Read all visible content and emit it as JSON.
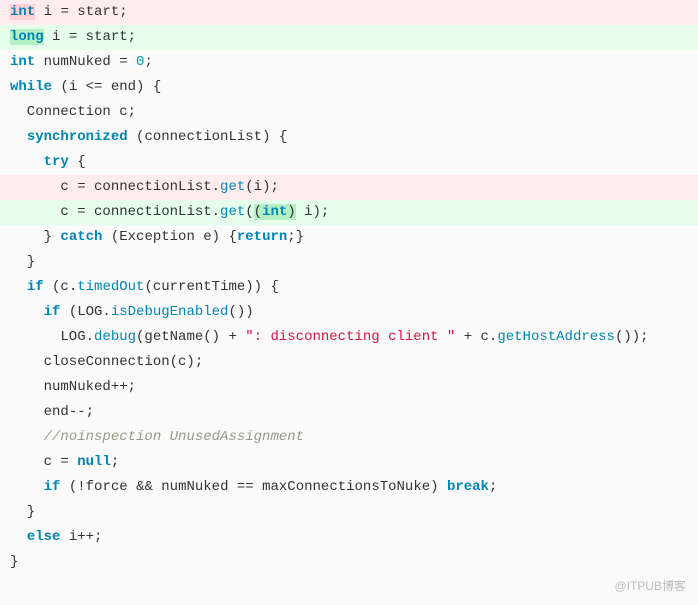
{
  "lines": [
    {
      "cls": "line line-removed",
      "parts": [
        {
          "t": "int",
          "c": "kw hl-removed"
        },
        {
          "t": " i "
        },
        {
          "t": "=",
          "c": "op"
        },
        {
          "t": " start;"
        }
      ]
    },
    {
      "cls": "line line-added",
      "parts": [
        {
          "t": "long",
          "c": "kw hl-added"
        },
        {
          "t": " i "
        },
        {
          "t": "=",
          "c": "op"
        },
        {
          "t": " start;"
        }
      ]
    },
    {
      "cls": "line",
      "parts": [
        {
          "t": "int",
          "c": "kw"
        },
        {
          "t": " numNuked "
        },
        {
          "t": "=",
          "c": "op"
        },
        {
          "t": " "
        },
        {
          "t": "0",
          "c": "num"
        },
        {
          "t": ";"
        }
      ]
    },
    {
      "cls": "line",
      "parts": [
        {
          "t": "while",
          "c": "kw"
        },
        {
          "t": " (i "
        },
        {
          "t": "<=",
          "c": "op"
        },
        {
          "t": " end) {"
        }
      ]
    },
    {
      "cls": "line",
      "parts": [
        {
          "t": "  Connection c;"
        }
      ]
    },
    {
      "cls": "line",
      "parts": [
        {
          "t": "  "
        },
        {
          "t": "synchronized",
          "c": "kw"
        },
        {
          "t": " (connectionList) {"
        }
      ]
    },
    {
      "cls": "line",
      "parts": [
        {
          "t": "    "
        },
        {
          "t": "try",
          "c": "kw"
        },
        {
          "t": " {"
        }
      ]
    },
    {
      "cls": "line line-removed",
      "parts": [
        {
          "t": "      c "
        },
        {
          "t": "=",
          "c": "op"
        },
        {
          "t": " connectionList."
        },
        {
          "t": "get",
          "c": "method"
        },
        {
          "t": "(i);"
        }
      ]
    },
    {
      "cls": "line line-added",
      "parts": [
        {
          "t": "      c "
        },
        {
          "t": "=",
          "c": "op"
        },
        {
          "t": " connectionList."
        },
        {
          "t": "get",
          "c": "method"
        },
        {
          "t": "("
        },
        {
          "t": "(",
          "c": "hl-added"
        },
        {
          "t": "int",
          "c": "kw hl-added"
        },
        {
          "t": ")",
          "c": "hl-added"
        },
        {
          "t": " i);"
        }
      ]
    },
    {
      "cls": "line",
      "parts": [
        {
          "t": "    } "
        },
        {
          "t": "catch",
          "c": "kw"
        },
        {
          "t": " (Exception e) {"
        },
        {
          "t": "return",
          "c": "kw"
        },
        {
          "t": ";}"
        }
      ]
    },
    {
      "cls": "line",
      "parts": [
        {
          "t": "  }"
        }
      ]
    },
    {
      "cls": "line",
      "parts": [
        {
          "t": "  "
        },
        {
          "t": "if",
          "c": "kw"
        },
        {
          "t": " (c."
        },
        {
          "t": "timedOut",
          "c": "method"
        },
        {
          "t": "(currentTime)) {"
        }
      ]
    },
    {
      "cls": "line",
      "parts": [
        {
          "t": "    "
        },
        {
          "t": "if",
          "c": "kw"
        },
        {
          "t": " (LOG."
        },
        {
          "t": "isDebugEnabled",
          "c": "method"
        },
        {
          "t": "())"
        }
      ]
    },
    {
      "cls": "line",
      "parts": [
        {
          "t": "      LOG."
        },
        {
          "t": "debug",
          "c": "method"
        },
        {
          "t": "(getName() "
        },
        {
          "t": "+",
          "c": "op"
        },
        {
          "t": " "
        },
        {
          "t": "\": disconnecting client \"",
          "c": "str"
        },
        {
          "t": " "
        },
        {
          "t": "+",
          "c": "op"
        },
        {
          "t": " c."
        },
        {
          "t": "getHostAddress",
          "c": "method"
        },
        {
          "t": "());"
        }
      ]
    },
    {
      "cls": "line",
      "parts": [
        {
          "t": "    closeConnection(c);"
        }
      ]
    },
    {
      "cls": "line",
      "parts": [
        {
          "t": "    numNuked"
        },
        {
          "t": "++",
          "c": "op"
        },
        {
          "t": ";"
        }
      ]
    },
    {
      "cls": "line",
      "parts": [
        {
          "t": "    end"
        },
        {
          "t": "--",
          "c": "op"
        },
        {
          "t": ";"
        }
      ]
    },
    {
      "cls": "line",
      "parts": [
        {
          "t": "    "
        },
        {
          "t": "//noinspection UnusedAssignment",
          "c": "comment"
        }
      ]
    },
    {
      "cls": "line",
      "parts": [
        {
          "t": "    c "
        },
        {
          "t": "=",
          "c": "op"
        },
        {
          "t": " "
        },
        {
          "t": "null",
          "c": "kw"
        },
        {
          "t": ";"
        }
      ]
    },
    {
      "cls": "line",
      "parts": [
        {
          "t": "    "
        },
        {
          "t": "if",
          "c": "kw"
        },
        {
          "t": " ("
        },
        {
          "t": "!",
          "c": "op"
        },
        {
          "t": "force "
        },
        {
          "t": "&&",
          "c": "op"
        },
        {
          "t": " numNuked "
        },
        {
          "t": "==",
          "c": "op"
        },
        {
          "t": " maxConnectionsToNuke) "
        },
        {
          "t": "break",
          "c": "kw"
        },
        {
          "t": ";"
        }
      ]
    },
    {
      "cls": "line",
      "parts": [
        {
          "t": "  }"
        }
      ]
    },
    {
      "cls": "line",
      "parts": [
        {
          "t": "  "
        },
        {
          "t": "else",
          "c": "kw"
        },
        {
          "t": " i"
        },
        {
          "t": "++",
          "c": "op"
        },
        {
          "t": ";"
        }
      ]
    },
    {
      "cls": "line",
      "parts": [
        {
          "t": "}"
        }
      ]
    }
  ],
  "watermark": "@ITPUB博客"
}
